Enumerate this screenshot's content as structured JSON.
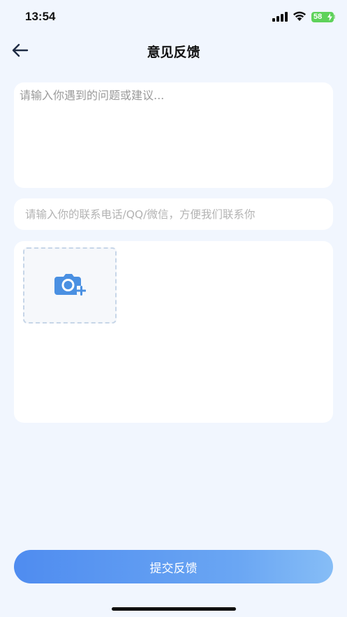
{
  "status_bar": {
    "time": "13:54",
    "battery_level": "58",
    "battery_color": "#5ed25a",
    "icons": [
      "signal-icon",
      "wifi-icon",
      "battery-icon"
    ]
  },
  "nav": {
    "back_icon": "arrow-left-icon",
    "title": "意见反馈"
  },
  "form": {
    "feedback_placeholder": "请输入你遇到的问题或建议...",
    "feedback_value": "",
    "contact_placeholder": "请输入你的联系电话/QQ/微信，方便我们联系你",
    "contact_value": "",
    "add_photo_icon": "camera-plus-icon"
  },
  "actions": {
    "submit_label": "提交反馈"
  },
  "colors": {
    "background": "#f1f6fe",
    "accent": "#4f8cf0",
    "icon_blue": "#4a90e2"
  }
}
